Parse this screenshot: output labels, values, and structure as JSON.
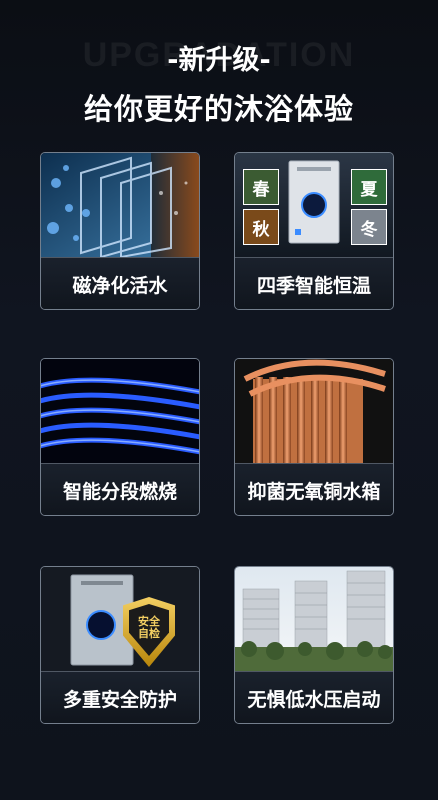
{
  "header": {
    "bg_word": "UPGRADATION",
    "badge": "-新升级-",
    "headline": "给你更好的沐浴体验"
  },
  "features": [
    {
      "label": "磁净化活水"
    },
    {
      "label": "四季智能恒温",
      "seasons": [
        "春",
        "夏",
        "秋",
        "冬"
      ]
    },
    {
      "label": "智能分段燃烧"
    },
    {
      "label": "抑菌无氧铜水箱"
    },
    {
      "label": "多重安全防护",
      "shield_text": "安全自检"
    },
    {
      "label": "无惧低水压启动"
    }
  ],
  "colors": {
    "background": "#0e131c",
    "accent": "#f3cf62",
    "flame": "#2a5cff"
  }
}
